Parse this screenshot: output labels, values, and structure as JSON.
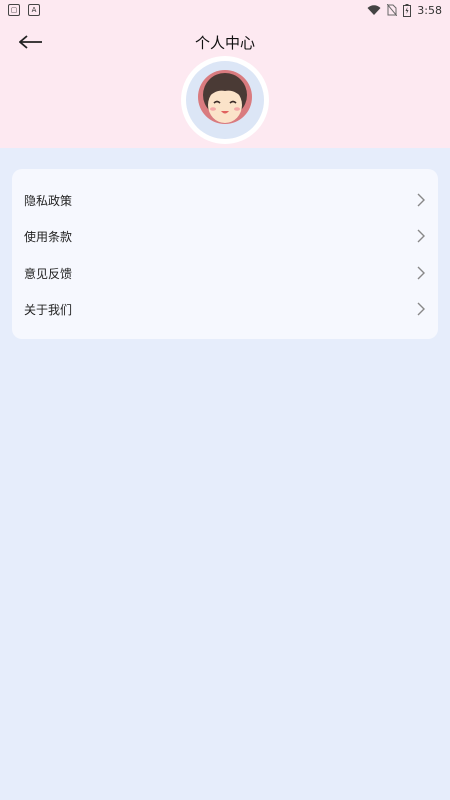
{
  "status_bar": {
    "time": "3:58",
    "left_icons": [
      "notification-icon",
      "a-icon"
    ],
    "right_icons": [
      "wifi-icon",
      "no-sim-icon",
      "battery-icon"
    ]
  },
  "header": {
    "title": "个人中心",
    "background": "#fde9f1"
  },
  "menu": {
    "items": [
      {
        "label": "隐私政策",
        "icon": "chevron-right-icon"
      },
      {
        "label": "使用条款",
        "icon": "chevron-right-icon"
      },
      {
        "label": "意见反馈",
        "icon": "chevron-right-icon"
      },
      {
        "label": "关于我们",
        "icon": "chevron-right-icon"
      }
    ]
  },
  "colors": {
    "page_bg": "#e6edfb",
    "card_bg": "#f6f8fe"
  }
}
